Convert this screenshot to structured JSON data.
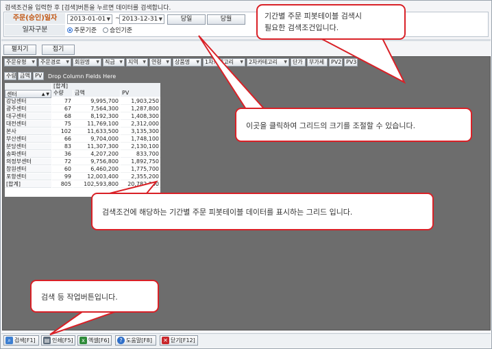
{
  "top_message": "검색조건을 입력한 후 [검색]버튼을 누르면 데이터를 검색합니다.",
  "search": {
    "date_label": "주문(승인)일자",
    "type_label": "일자구분",
    "from_date": "2013-01-01",
    "to_date": "2013-12-31",
    "tilde": "~",
    "period_buttons": [
      "당일",
      "당월"
    ],
    "radios": [
      {
        "label": "주문기준",
        "checked": true
      },
      {
        "label": "승인기준",
        "checked": false
      }
    ]
  },
  "grid_toolbar": {
    "expand": "펼치기",
    "collapse": "접기"
  },
  "pivot": {
    "row_fields": [
      "주문유형",
      "주문경로",
      "회원명",
      "직급",
      "지역",
      "연령",
      "상품명",
      "1차카테고리",
      "2차카테고리",
      "단가",
      "부가세",
      "PV2",
      "PV3"
    ],
    "data_fields": [
      "수량",
      "금액",
      "PV"
    ],
    "drop_hint": "Drop Column Fields Here",
    "row_header": "센터",
    "total_header": "[합계]",
    "col_headers": [
      "수량",
      "금액",
      "PV"
    ],
    "rows": [
      {
        "center": "강남센터",
        "qty": "77",
        "amount": "9,995,700",
        "pv": "1,903,250"
      },
      {
        "center": "광주센터",
        "qty": "67",
        "amount": "7,564,300",
        "pv": "1,287,800"
      },
      {
        "center": "대구센터",
        "qty": "68",
        "amount": "8,192,300",
        "pv": "1,408,300"
      },
      {
        "center": "대전센터",
        "qty": "75",
        "amount": "11,769,100",
        "pv": "2,312,000"
      },
      {
        "center": "본사",
        "qty": "102",
        "amount": "11,633,500",
        "pv": "3,135,300"
      },
      {
        "center": "부산센터",
        "qty": "66",
        "amount": "9,704,000",
        "pv": "1,748,100"
      },
      {
        "center": "분당센터",
        "qty": "83",
        "amount": "11,307,300",
        "pv": "2,130,100"
      },
      {
        "center": "송파센터",
        "qty": "36",
        "amount": "4,207,200",
        "pv": "833,700"
      },
      {
        "center": "의정부센터",
        "qty": "72",
        "amount": "9,756,800",
        "pv": "1,892,750"
      },
      {
        "center": "창원센터",
        "qty": "60",
        "amount": "6,460,200",
        "pv": "1,775,700"
      },
      {
        "center": "포항센터",
        "qty": "99",
        "amount": "12,003,400",
        "pv": "2,355,200"
      },
      {
        "center": "[합계]",
        "qty": "805",
        "amount": "102,593,800",
        "pv": "20,782,200"
      }
    ]
  },
  "bottom_buttons": [
    {
      "label": "검색[F1]",
      "icon": "search-icon",
      "color": "#3d7fd1"
    },
    {
      "label": "인쇄[F5]",
      "icon": "printer-icon",
      "color": "#5c6b7a"
    },
    {
      "label": "엑셀[F6]",
      "icon": "excel-icon",
      "color": "#2e8b3a"
    },
    {
      "label": "도움말[F8]",
      "icon": "help-icon",
      "color": "#2f6fc9"
    },
    {
      "label": "닫기[F12]",
      "icon": "close-icon",
      "color": "#c8262b"
    }
  ],
  "callouts": {
    "search_conditions": [
      "기간별 주문 피봇테이블 검색시",
      "필요한 검색조건입니다."
    ],
    "resize": "이곳을 클릭하여 그리드의 크기를 조절할 수 있습니다.",
    "grid": "검색조건에 해당하는 기간별 주문 피봇테이블 데이터를 표시하는 그리드 입니다.",
    "buttons": "검색 등 작업버튼입니다."
  },
  "colors": {
    "callout_border": "#d92026",
    "label_orange": "#c25510",
    "pivot_bg": "#6d6d6d"
  }
}
